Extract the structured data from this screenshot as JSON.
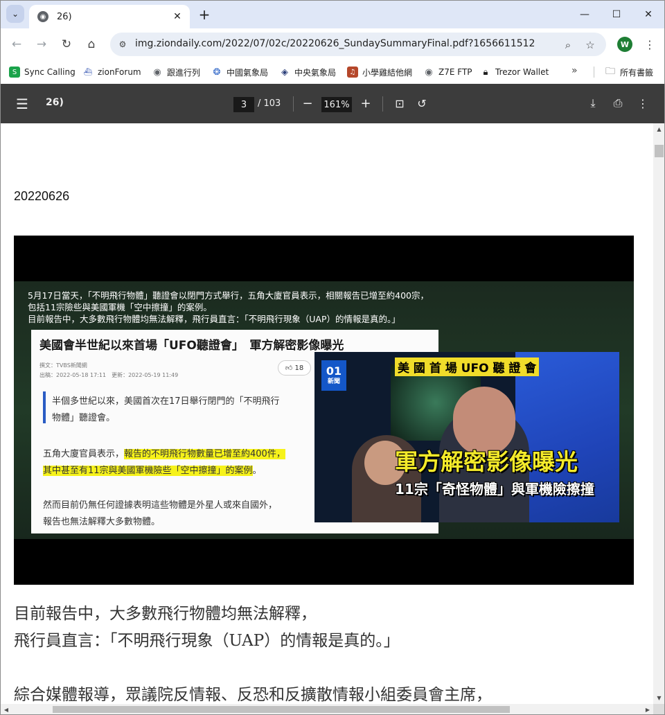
{
  "browser": {
    "tab_title": "26)",
    "url": "img.ziondaily.com/2022/07/02c/20220626_SundaySummaryFinal.pdf?1656611512",
    "profile_initial": "W"
  },
  "bookmarks": [
    {
      "label": "Sync Calling",
      "icon": "sync-calling-icon",
      "color": "#1aa34a"
    },
    {
      "label": "zionForum",
      "icon": "ship-icon",
      "color": "#3b5bb5"
    },
    {
      "label": "跟進行列",
      "icon": "globe-icon",
      "color": "#5f6368"
    },
    {
      "label": "中國氣象局",
      "icon": "cma-icon",
      "color": "#2b63c6"
    },
    {
      "label": "中央氣象局",
      "icon": "cwb-icon",
      "color": "#2b3f7a"
    },
    {
      "label": "小學雞結他網",
      "icon": "guitar-icon",
      "color": "#b5472a"
    },
    {
      "label": "Z7E FTP",
      "icon": "globe-icon",
      "color": "#5f6368"
    },
    {
      "label": "Trezor Wallet",
      "icon": "lock-icon",
      "color": "#1f1f1f"
    }
  ],
  "bookmarks_folder": "所有書籤",
  "pdf": {
    "title": "26)",
    "page": "3",
    "total": "/ 103",
    "zoom": "161%"
  },
  "page": {
    "date": "20220626",
    "video": {
      "captions": [
        "5月17日當天，「不明飛行物體」聽證會以閉門方式舉行，五角大廈官員表示，相關報告已增至約400宗，",
        "包括11宗險些與美國軍機「空中擦撞」的案例。",
        "目前報告中，大多數飛行物體均無法解釋，飛行員直言：「不明飛行現象（UAP）的情報是真的。」"
      ],
      "article_title": "美國會半世紀以來首場「UFO聽證會」　軍方解密影像曝光",
      "article_byline": "撰文：TVBS新聞網",
      "article_dates": "出稿：2022-05-18 17:11　更新：2022-05-19 11:49",
      "likes": "18",
      "quote_line1": "半個多世紀以來，美國首次在17日舉行閉門的「不明飛行",
      "quote_line2": "物體」聽證會。",
      "para2_prefix": "五角大廈官員表示，",
      "para2_highlight1": "報告的不明飛行物數量已增至約400件，",
      "para2_highlight2": "其中甚至有11宗與美國軍機險些「空中擦撞」的案例",
      "para2_suffix": "。",
      "para3_line1": "然而目前仍無任何證據表明這些物體是外星人或來自國外，",
      "para3_line2": "報告也無法解釋大多數物體。",
      "news_logo": "01",
      "news_logo_sub": "新聞",
      "news_top": "美 國 首 場 UFO 聽 證 會",
      "news_headline": "軍方解密影像曝光",
      "news_sub": "11宗「奇怪物體」與軍機險擦撞"
    },
    "body_lines": [
      "目前報告中，大多數飛行物體均無法解釋，",
      "飛行員直言：「不明飛行現象（UAP）的情報是真的。」",
      "綜合媒體報導，眾議院反情報、反恐和反擴散情報小組委員會主席，"
    ]
  }
}
